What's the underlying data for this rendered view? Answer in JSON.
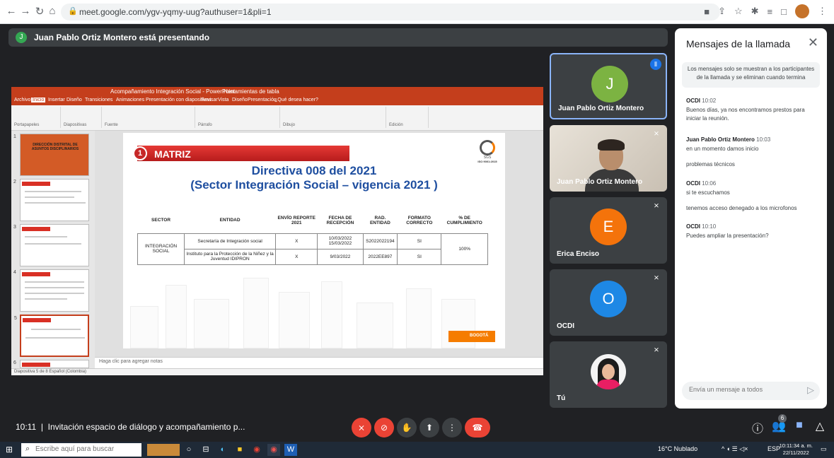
{
  "browser": {
    "url": "meet.google.com/ygv-yqmy-uug?authuser=1&pli=1"
  },
  "presenter": {
    "initial": "J",
    "banner": "Juan Pablo Ortiz Montero está presentando"
  },
  "ppt": {
    "window_title": "Acompañamiento Integración Social - PowerPoint",
    "context_tab": "Herramientas de tabla",
    "tabs": [
      "Archivo",
      "Inicio",
      "Insertar",
      "Diseño",
      "Transiciones",
      "Animaciones",
      "Presentación con diapositivas",
      "Revisar",
      "Vista",
      "Diseño",
      "Presentación",
      "¿Qué desea hacer?"
    ],
    "ribbon_groups": [
      "Portapapeles",
      "Diapositivas",
      "Fuente",
      "Párrafo",
      "Dibujo",
      "Edición"
    ],
    "notes_placeholder": "Haga clic para agregar notas",
    "status": "Diapositiva 5 de 8   Español (Colombia)",
    "thumb_numbers": [
      "1",
      "2",
      "3",
      "4",
      "5",
      "6"
    ],
    "thumb1_title": "DIRECCIÓN DISTRITAL DE ASUNTOS DISCIPLINARIOS"
  },
  "slide": {
    "number": "1",
    "section": "MATRIZ",
    "logo_text": "SGS",
    "logo_cert": "ISO 9001:2015",
    "title_line1": "Directiva 008 del 2021",
    "title_line2": "(Sector Integración Social – vigencia 2021 )",
    "footer": "BOGOTÁ",
    "table": {
      "headers": [
        "SECTOR",
        "ENTIDAD",
        "ENVÍO REPORTE 2021",
        "FECHA DE RECEPCIÓN",
        "RAD. ENTIDAD",
        "FORMATO CORRECTO",
        "% DE CUMPLIMIENTO"
      ],
      "sector": "INTEGRACIÓN SOCIAL",
      "rows": [
        {
          "entidad": "Secretaría de Integración social",
          "envio": "X",
          "fecha": "10/03/2022 15/03/2022",
          "rad": "S2022022194",
          "formato": "SI"
        },
        {
          "entidad": "Instituto para la Protección de la Niñez y la Juventud IDIPRON",
          "envio": "X",
          "fecha": "9/03/2022",
          "rad": "2022EE897",
          "formato": "SI"
        }
      ],
      "cumplimiento": "100%"
    }
  },
  "participants": [
    {
      "name": "Juan Pablo Ortiz Montero",
      "initial": "J",
      "color": "#7cb342"
    },
    {
      "name": "Juan Pablo Ortiz Montero"
    },
    {
      "name": "Erica Enciso",
      "initial": "E",
      "color": "#f4730b"
    },
    {
      "name": "OCDI",
      "initial": "O",
      "color": "#1e88e5"
    },
    {
      "name": "Tú"
    }
  ],
  "chat": {
    "title": "Mensajes de la llamada",
    "notice": "Los mensajes solo se muestran a los participantes de la llamada y se eliminan cuando termina",
    "messages": [
      {
        "sender": "OCDI",
        "time": "10:02",
        "texts": [
          "Buenos días, ya nos encontramos prestos para iniciar la reunión."
        ]
      },
      {
        "sender": "Juan Pablo Ortiz Montero",
        "time": "10:03",
        "texts": [
          "en un momento damos inicio",
          "problemas técnicos"
        ]
      },
      {
        "sender": "OCDI",
        "time": "10:06",
        "texts": [
          "si te escuchamos",
          "tenemos acceso denegado a los microfonos"
        ]
      },
      {
        "sender": "OCDI",
        "time": "10:10",
        "texts": [
          "Puedes ampliar la presentación?"
        ]
      }
    ],
    "input_placeholder": "Envía un mensaje a todos"
  },
  "meeting": {
    "time": "10:11",
    "separator": "|",
    "name": "Invitación espacio de diálogo y acompañamiento p...",
    "participant_count": "6"
  },
  "taskbar": {
    "search_placeholder": "Escribe aquí para buscar",
    "weather": "16°C  Nublado",
    "lang": "ESP",
    "clock_time": "10:11:34 a. m.",
    "clock_date": "22/11/2022"
  },
  "colors": {
    "meet_bg": "#202124",
    "ppt_accent": "#c43e1c",
    "end_call": "#ea4335",
    "active_border": "#8ab4f8"
  },
  "icons": {
    "back": "arrow-left",
    "forward": "arrow-right",
    "reload": "reload",
    "home": "home",
    "lock": "lock",
    "close": "close",
    "send": "send",
    "mic_off": "mic-off",
    "cam_off": "camera-off",
    "hand": "raise-hand",
    "present": "present",
    "more": "more-vert",
    "end": "phone-end",
    "info": "info",
    "people": "people",
    "chat": "chat",
    "activities": "shapes"
  }
}
